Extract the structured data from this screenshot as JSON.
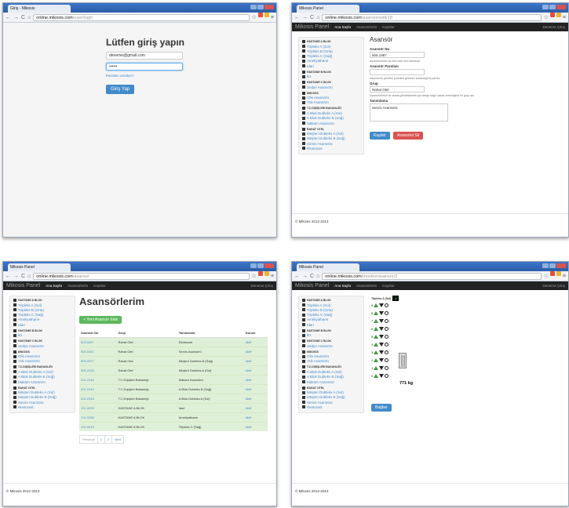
{
  "screen1": {
    "tab_title": "Giriş - Mikosis",
    "url_host": "online.mikosis.com",
    "url_path": "/user/login",
    "login_title": "Lütfen giriş yapın",
    "email_value": "deneme@gmail.com",
    "password_value": "••••••",
    "forgot_link": "Parolanı unuttun?",
    "login_button": "Giriş Yap"
  },
  "nav": {
    "brand": "Mikosis Panel",
    "home": "Ana Sayfa",
    "elevators": "Asansörlerim",
    "records": "Kayıtlar",
    "logout": "Deneme Çıkış"
  },
  "screen2": {
    "tab_title": "Mikosis Panel",
    "url_host": "online.mikosis.com",
    "url_path": "/asansor/edit/18",
    "title": "Asansör",
    "no_label": "Asansör No",
    "no_value": "505.1987",
    "no_help": "Asansörünüze ait olan özel seri numarası.",
    "pwd_label": "Asansör Parolası",
    "pwd_value": "",
    "pwd_help": "Asansörün yönetim paneline girerken kullandığınız parola.",
    "group_label": "Grup",
    "group_value": "Rahat Otel",
    "group_help": "Asansörlerinizi bir arada görüntülemek için isteğe bağlı olarak vereceğiniz bir grup adı.",
    "desc_label": "Tanımlama",
    "desc_value": "Servis Asansörü",
    "save_button": "Kaydet",
    "delete_button": "Asansörü Sil"
  },
  "sidebar": [
    {
      "section": "HASTANE A BLOK",
      "items": [
        "Tripleks A (Sol)",
        "Tripleks B (Orta)",
        "Tripleks C (Sağ)",
        "Ameliyathane",
        "Idari"
      ]
    },
    {
      "section": "HASTANE B BLOK",
      "items": [
        "B1"
      ]
    },
    {
      "section": "HASTANE C BLOK",
      "items": [
        "Sedye Asansörü"
      ]
    },
    {
      "section": "MIKOSIS",
      "items": [
        "Ofis Asansörü",
        "Yük Asansörü"
      ]
    },
    {
      "section": "T.C.DIŞIŞLERI BAKANLIĞI",
      "items": [
        "A Blok Dubleks A (Sol)",
        "A Blok Dubleks B (Sağ)",
        "Makam Asansörü"
      ]
    },
    {
      "section": "RAHAT OTEL",
      "items": [
        "Müşteri Dubleks A (Sol)",
        "Müşteri Dubleks B (Sağ)",
        "Servis Asansörü",
        "Restorant"
      ]
    }
  ],
  "footer": "© Mikosis 2012-2013",
  "screen3": {
    "tab_title": "Mikosis Panel",
    "url_host": "online.mikosis.com",
    "url_path": "/asansor",
    "title": "Asansörlerim",
    "new_button": "+ Yeni Asansör Ekle",
    "columns": [
      "Asansör No",
      "Grup",
      "Tanımlama",
      "Durum"
    ],
    "rows": [
      [
        "503.0087",
        "Rahat Otel",
        "Restorant",
        "Aktif"
      ],
      [
        "505.1987",
        "Rahat Otel",
        "Servis Asansörü",
        "Aktif"
      ],
      [
        "505.2007",
        "Rahat Otel",
        "Müşteri Dubleks B (Sağ)",
        "Aktif"
      ],
      [
        "505.2025",
        "Rahat Otel",
        "Müşteri Dubleks A (Sol)",
        "Aktif"
      ],
      [
        "201.2344",
        "T.C.Dışişleri Bakanlığı",
        "Makam Asansörü",
        "Aktif"
      ],
      [
        "201.2344",
        "T.C.Dışişleri Bakanlığı",
        "A Blok Dubleks B (Sağ)",
        "Aktif"
      ],
      [
        "201.2343",
        "T.C.Dışişleri Bakanlığı",
        "A Blok Dubleks A (Sol)",
        "Aktif"
      ],
      [
        "101.0209",
        "HASTANE A BLOK",
        "Idari",
        "Aktif"
      ],
      [
        "101.0208",
        "HASTANE A BLOK",
        "Ameliyathane",
        "Aktif"
      ],
      [
        "101.0049",
        "HASTANE A BLOK",
        "Tripleks C (Sağ)",
        "Aktif"
      ]
    ],
    "pager": {
      "prev": "Previous",
      "p1": "1",
      "p2": "2",
      "next": "Next"
    }
  },
  "screen4": {
    "tab_title": "Mikosis Panel",
    "url_host": "online.mikosis.com",
    "url_path": "/monitor/asansor/3",
    "header": "Tripleks A (Sol)",
    "badge": "4",
    "floors": [
      "9",
      "8",
      "7",
      "6",
      "5",
      "4",
      "3",
      "2",
      "1",
      "0"
    ],
    "weight": "771 kg",
    "connect_button": "Bağlan"
  }
}
